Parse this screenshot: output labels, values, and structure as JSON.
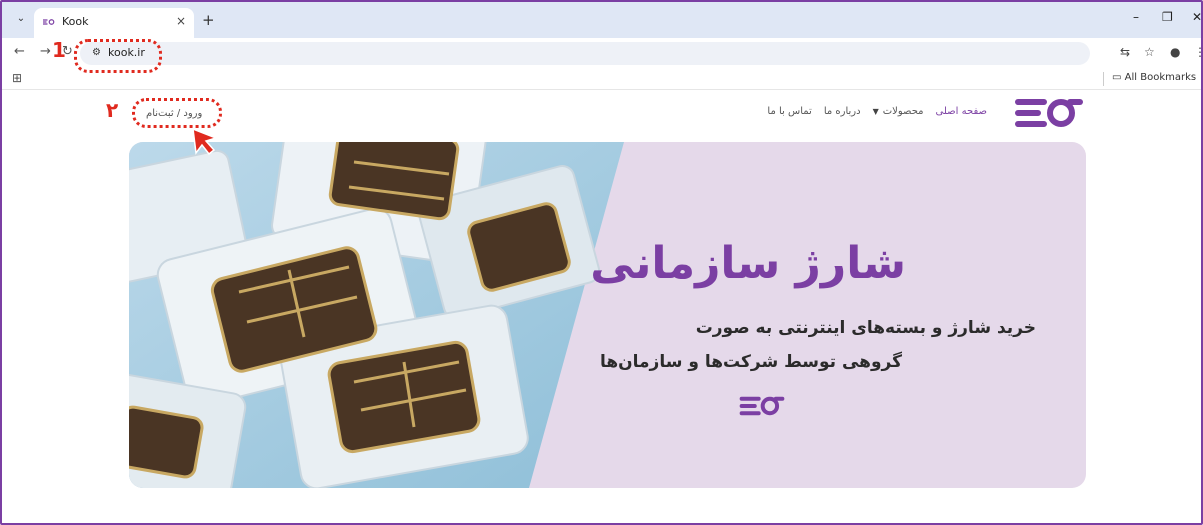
{
  "browser": {
    "tab_title": "Kook",
    "tab_close": "×",
    "new_tab": "+",
    "url": "kook.ir",
    "bookmarks_all": "All Bookmarks"
  },
  "site": {
    "nav": {
      "home": "صفحه اصلی",
      "products": "محصولات",
      "about": "درباره ما",
      "contact": "تماس با ما"
    },
    "login_label": "ورود / ثبت‌نام",
    "hero": {
      "title": "شارژ سازمانی",
      "subtitle_line1": "خرید شارژ و بسته‌های اینترنتی به صورت",
      "subtitle_line2": "گروهی توسط شرکت‌ها و سازمان‌ها"
    }
  },
  "annotations": {
    "step1": "1",
    "step2": "۲"
  },
  "colors": {
    "accent": "#7b3fa3",
    "annotation": "#e02a1f",
    "hero_bg": "#e5d9ea",
    "frame": "#7b3fa3"
  },
  "icons": [
    "tab-menu-icon",
    "close-icon",
    "plus-icon",
    "back-icon",
    "forward-icon",
    "reload-icon",
    "site-info-icon",
    "translate-icon",
    "star-icon",
    "profile-icon",
    "more-icon",
    "apps-icon",
    "folder-icon",
    "minimize-icon",
    "maximize-icon",
    "chevron-down-icon",
    "cursor-arrow-icon"
  ]
}
